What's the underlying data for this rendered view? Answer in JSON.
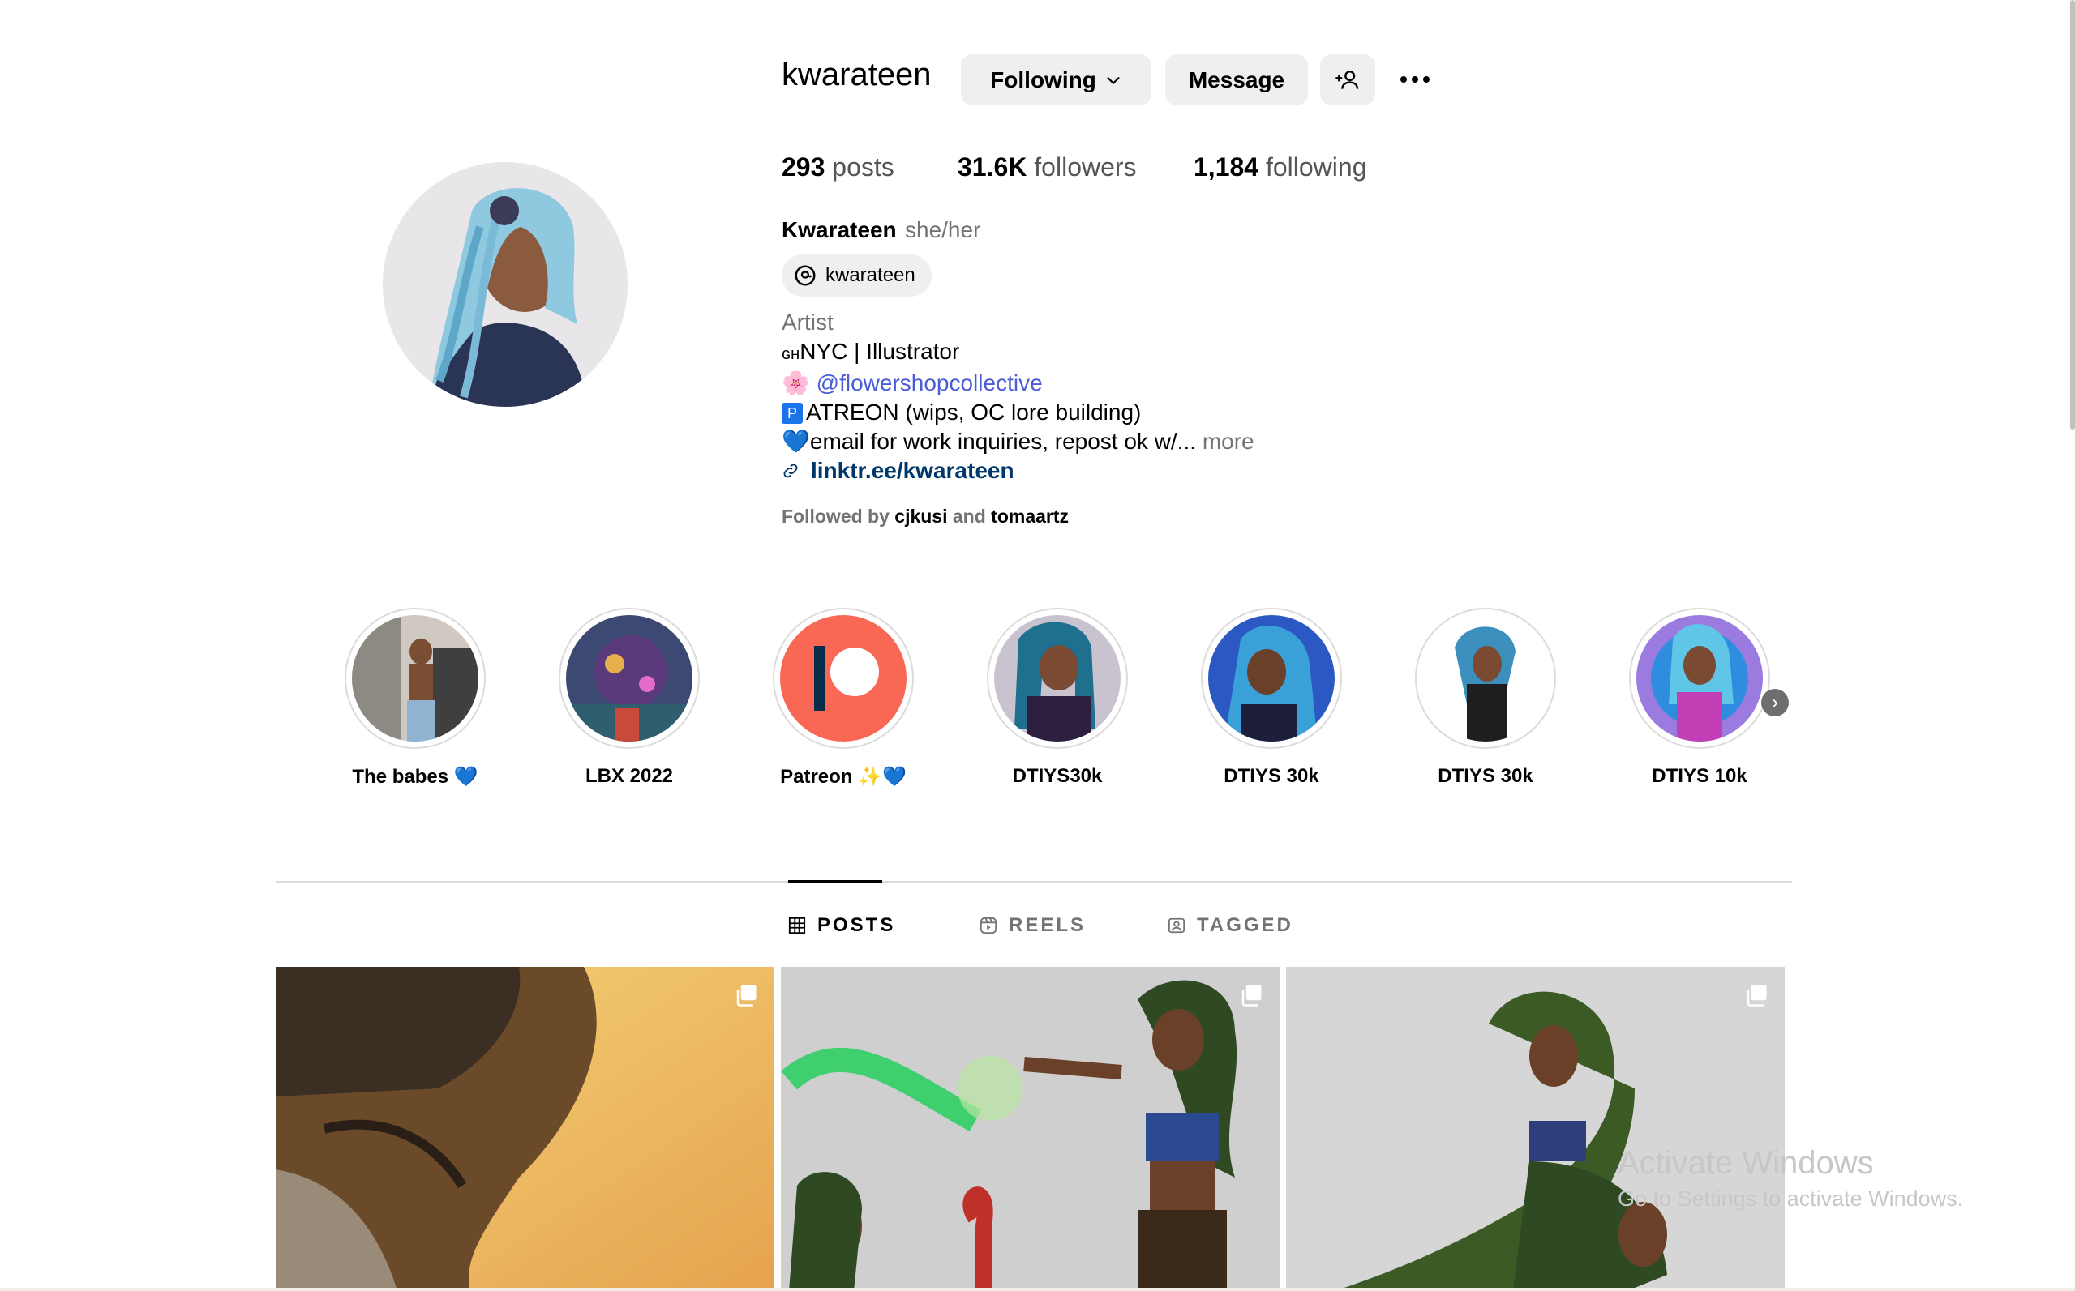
{
  "profile": {
    "username": "kwarateen",
    "following_label": "Following",
    "message_label": "Message",
    "posts_count": "293",
    "posts_label": "posts",
    "followers_count": "31.6K",
    "followers_label": "followers",
    "following_count": "1,184",
    "following_count_label": "following",
    "full_name": "Kwarateen",
    "pronouns": "she/her",
    "threads_handle": "kwarateen",
    "bio": {
      "category": "Artist",
      "line1_prefix": "ɢʜ",
      "line1": "NYC | Illustrator",
      "line2_emoji": "🌸",
      "line2_mention": "@flowershopcollective",
      "line3_badge": "P",
      "line3": "ATREON (wips, OC lore building)",
      "line4_emoji": "💙",
      "line4": "email for work inquiries, repost ok w/...",
      "more_label": "more",
      "link": "linktr.ee/kwarateen"
    },
    "followed_by_prefix": "Followed by",
    "followed_by_1": "cjkusi",
    "followed_by_and": "and",
    "followed_by_2": "tomaartz"
  },
  "highlights": [
    {
      "label": "The babes 💙"
    },
    {
      "label": "LBX 2022"
    },
    {
      "label": "Patreon ✨💙"
    },
    {
      "label": "DTIYS30k"
    },
    {
      "label": "DTIYS 30k"
    },
    {
      "label": "DTIYS 30k"
    },
    {
      "label": "DTIYS 10k"
    }
  ],
  "tabs": [
    {
      "label": "POSTS",
      "icon": "grid-icon",
      "active": true
    },
    {
      "label": "REELS",
      "icon": "reels-icon",
      "active": false
    },
    {
      "label": "TAGGED",
      "icon": "tagged-icon",
      "active": false
    }
  ],
  "watermark": {
    "line1": "Activate Windows",
    "line2": "Go to Settings to activate Windows."
  },
  "colors": {
    "patreon": "#f96854",
    "link": "#00376b",
    "mention": "#4a5dd8"
  }
}
